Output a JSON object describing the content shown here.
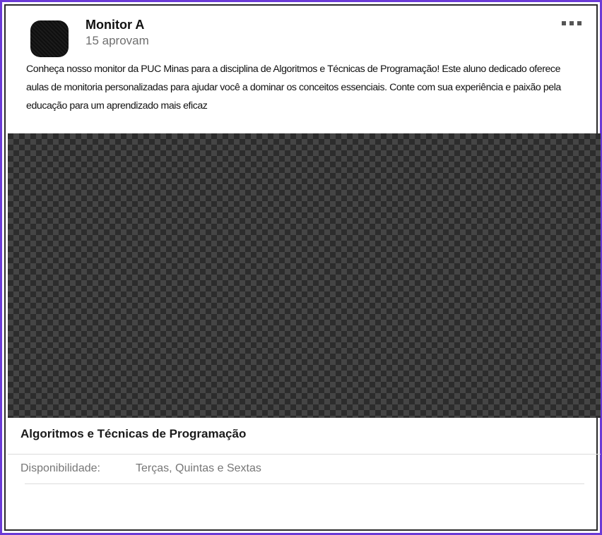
{
  "post": {
    "author_name": "Monitor A",
    "approvals": "15 aprovam",
    "avatar_icon": "avatar",
    "more_icon": "more-horizontal-icon",
    "description": "Conheça nosso monitor da PUC Minas para a disciplina de Algoritmos e Técnicas de Programação! Este aluno dedicado oferece aulas de monitoria personalizadas para ajudar você a dominar os conceitos essenciais. Conte com sua experiência e paixão pela educação para um aprendizado mais eficaz"
  },
  "course": {
    "title": "Algoritmos e Técnicas de Programação",
    "availability_label": "Disponibilidade:",
    "availability_value": "Terças, Quintas e Sextas"
  },
  "colors": {
    "frame_border": "#6b3ad6",
    "image_placeholder_dark": "#2c2c2c",
    "image_placeholder_light": "#454545"
  }
}
